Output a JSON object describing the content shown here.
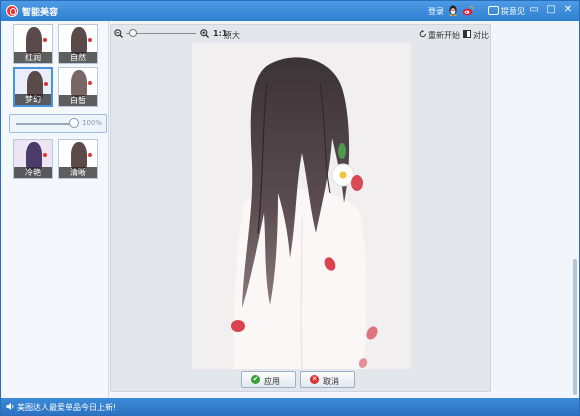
{
  "window": {
    "title": "智能美容",
    "login": "登录",
    "feedback": "提意见",
    "minimize_glyph": "▭",
    "maximize_glyph": "□",
    "close_glyph": "✕"
  },
  "effects": [
    {
      "label": "红润",
      "selected": false
    },
    {
      "label": "自然",
      "selected": false
    },
    {
      "label": "梦幻",
      "selected": true
    },
    {
      "label": "白皙",
      "selected": false
    },
    {
      "label": "冷艳",
      "selected": false
    },
    {
      "label": "清晰",
      "selected": false
    }
  ],
  "intensity": {
    "value": "100%",
    "fraction": 1.0
  },
  "toolbar": {
    "one_to_one": "1:1",
    "original": "原大",
    "restart": "重新开始",
    "compare": "对比",
    "zoom_fraction": 0.1
  },
  "buttons": {
    "apply": "应用",
    "cancel": "取消"
  },
  "status": {
    "text": "美图达人最爱单品今日上新!"
  },
  "colors": {
    "title_bar": "#2f7fd2",
    "accent": "#4a92e2",
    "apply_icon": "#3aa035",
    "cancel_icon": "#d83030"
  }
}
